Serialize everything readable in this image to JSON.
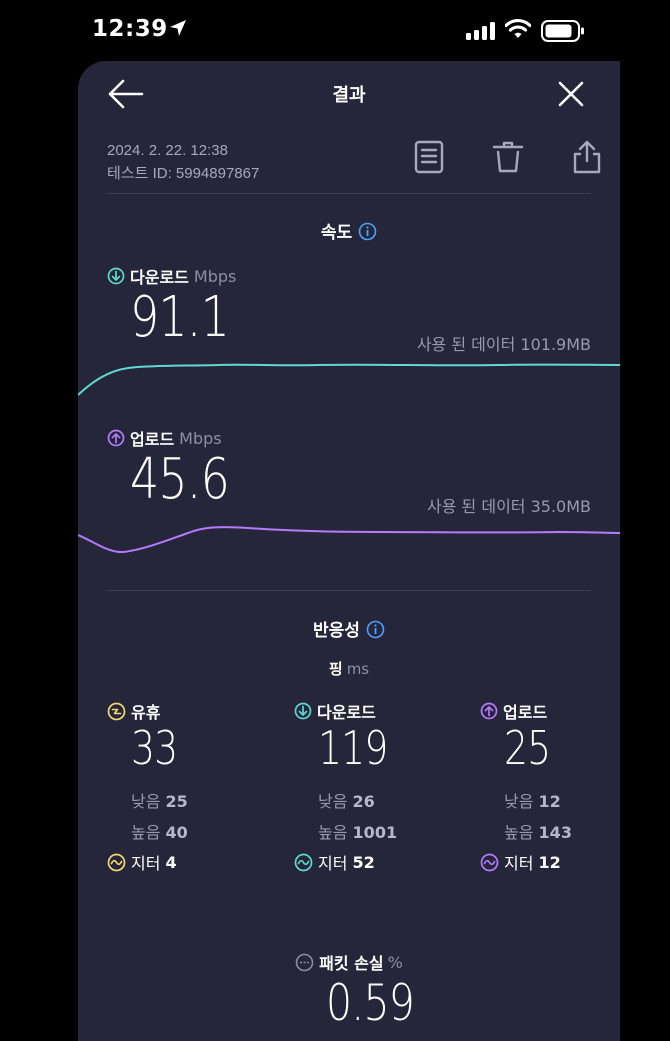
{
  "status_bar": {
    "time": "12:39"
  },
  "nav": {
    "title": "결과"
  },
  "meta": {
    "date": "2024. 2. 22. 12:38",
    "test_id": "테스트 ID: 5994897867"
  },
  "speed": {
    "title": "속도",
    "download": {
      "label": "다운로드",
      "unit": "Mbps",
      "value": "91.1",
      "data_used": "사용 된 데이터 101.9MB"
    },
    "upload": {
      "label": "업로드",
      "unit": "Mbps",
      "value": "45.6",
      "data_used": "사용 된 데이터 35.0MB"
    }
  },
  "responsiveness": {
    "title": "반응성",
    "ping_label": "핑",
    "ping_unit": "ms",
    "idle": {
      "label": "유휴",
      "value": "33",
      "low_label": "낮음",
      "low": "25",
      "high_label": "높음",
      "high": "40",
      "jitter_label": "지터",
      "jitter": "4"
    },
    "download": {
      "label": "다운로드",
      "value": "119",
      "low_label": "낮음",
      "low": "26",
      "high_label": "높음",
      "high": "1001",
      "jitter_label": "지터",
      "jitter": "52"
    },
    "upload": {
      "label": "업로드",
      "value": "25",
      "low_label": "낮음",
      "low": "12",
      "high_label": "높음",
      "high": "143",
      "jitter_label": "지터",
      "jitter": "12"
    }
  },
  "packet_loss": {
    "label": "패킷 손실",
    "unit": "%",
    "value": "0.59"
  },
  "colors": {
    "download": "#5fd9d3",
    "upload": "#b57bff",
    "idle": "#f2d873",
    "info": "#4aa3ff",
    "sheet": "#26263a"
  }
}
